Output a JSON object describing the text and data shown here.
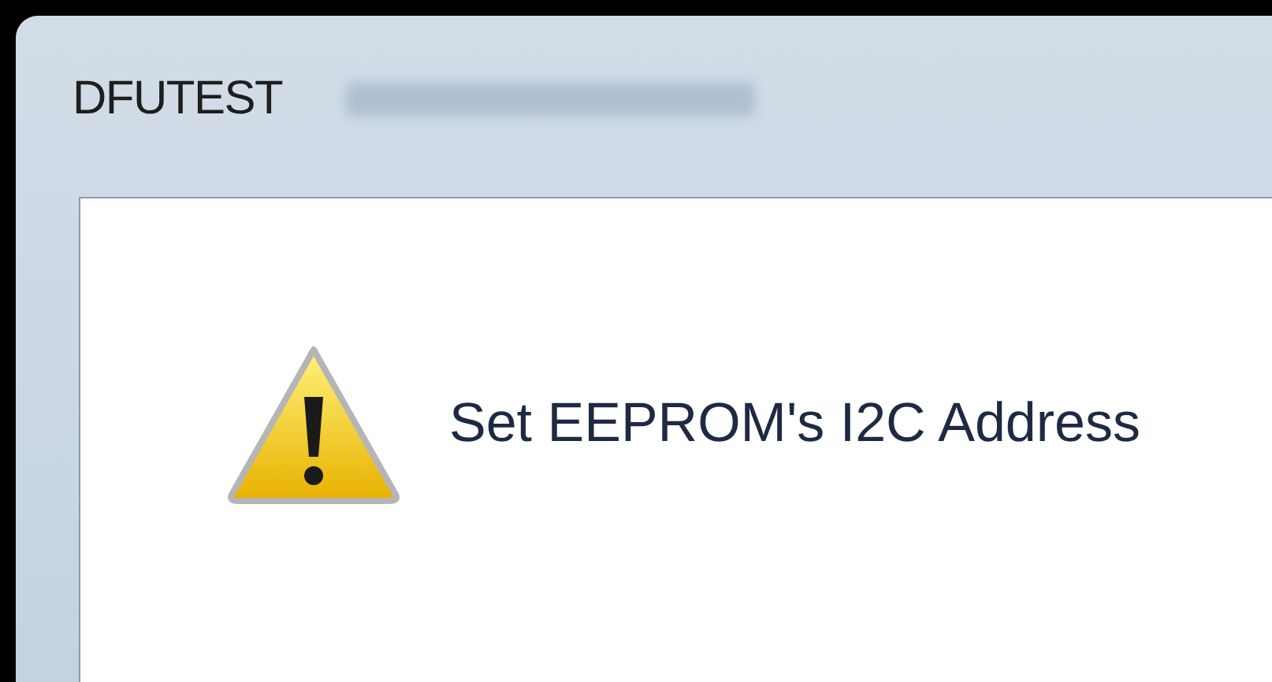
{
  "window": {
    "title": "DFUTEST"
  },
  "message": {
    "text": "Set EEPROM's I2C Address"
  }
}
